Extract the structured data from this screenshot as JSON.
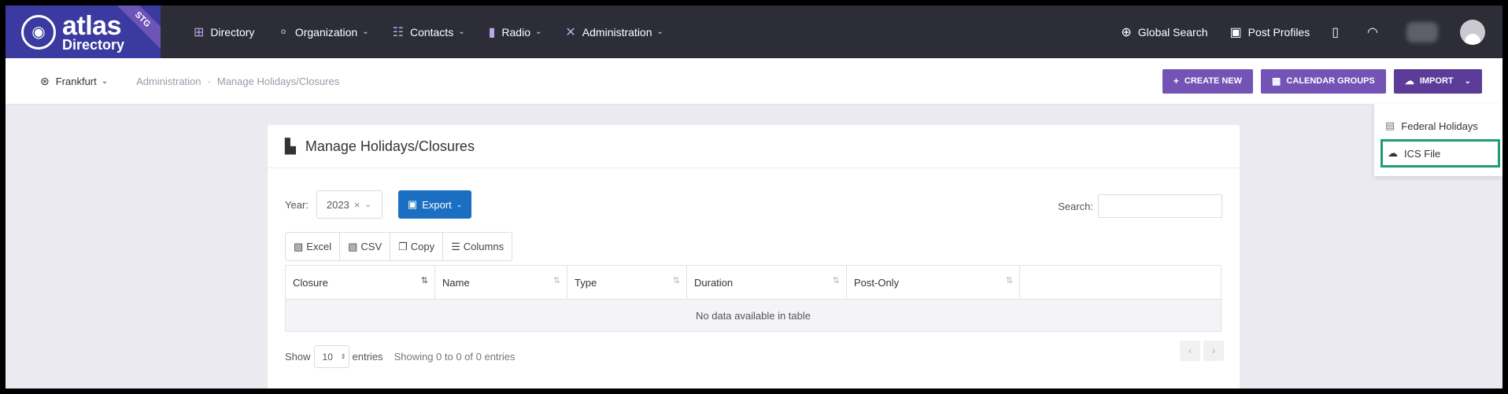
{
  "brand": {
    "name": "atlas",
    "sub": "Directory",
    "env": "STG"
  },
  "nav": {
    "items": [
      {
        "label": "Directory",
        "icon": "directory-icon",
        "glyph": "⊞",
        "dropdown": false
      },
      {
        "label": "Organization",
        "icon": "organization-icon",
        "glyph": "⚬",
        "dropdown": true
      },
      {
        "label": "Contacts",
        "icon": "contacts-icon",
        "glyph": "☷",
        "dropdown": true
      },
      {
        "label": "Radio",
        "icon": "radio-icon",
        "glyph": "▮",
        "dropdown": true
      },
      {
        "label": "Administration",
        "icon": "tools-icon",
        "glyph": "✕",
        "dropdown": true
      }
    ],
    "right": {
      "global_search": "Global Search",
      "post_profiles": "Post Profiles"
    }
  },
  "subbar": {
    "location": "Frankfurt",
    "breadcrumb": [
      "Administration",
      "Manage Holidays/Closures"
    ],
    "create_new": "CREATE NEW",
    "calendar_groups": "CALENDAR GROUPS",
    "import": "IMPORT"
  },
  "import_menu": {
    "federal_holidays": "Federal Holidays",
    "ics_file": "ICS File"
  },
  "card": {
    "title": "Manage Holidays/Closures",
    "year_label": "Year:",
    "year_value": "2023",
    "export_label": "Export",
    "search_label": "Search:",
    "buttons": {
      "excel": "Excel",
      "csv": "CSV",
      "copy": "Copy",
      "columns": "Columns"
    },
    "columns": [
      "Closure",
      "Name",
      "Type",
      "Duration",
      "Post-Only",
      ""
    ],
    "empty": "No data available in table",
    "show": "Show",
    "length": "10",
    "entries": "entries",
    "info": "Showing 0 to 0 of 0 entries"
  },
  "colors": {
    "nav_bg": "#2c2d36",
    "brand_bg": "#3a3aa0",
    "accent": "#7353b6",
    "export": "#1b6fc2",
    "highlight": "#1e9c76"
  }
}
